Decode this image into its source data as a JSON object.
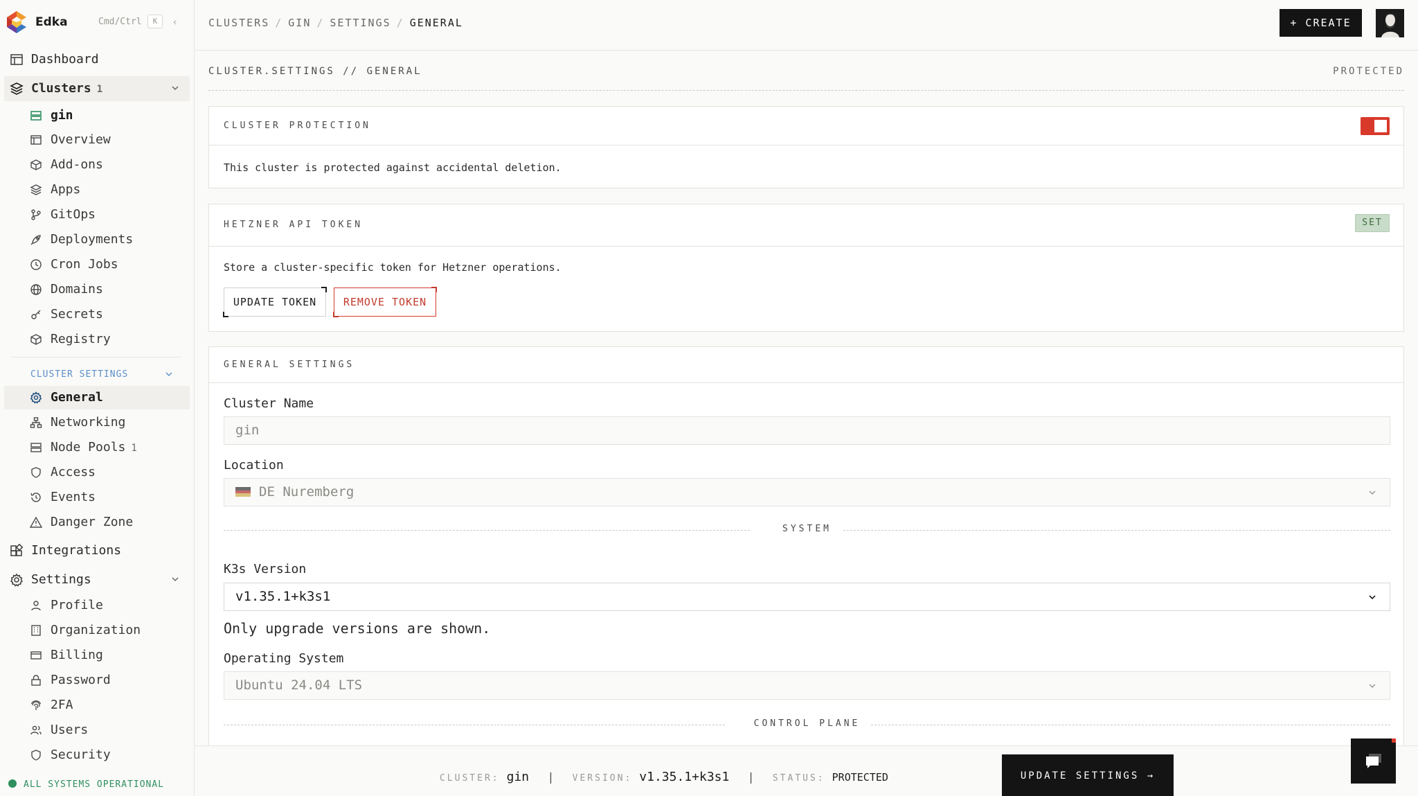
{
  "app": {
    "name": "Edka",
    "shortcut": "Cmd/Ctrl",
    "shortcut_key": "K"
  },
  "sidebar": {
    "dashboard": "Dashboard",
    "clusters": {
      "label": "Clusters",
      "count": "1"
    },
    "cluster_name": "gin",
    "cluster_items": [
      {
        "label": "Overview",
        "icon": "layout-icon"
      },
      {
        "label": "Add-ons",
        "icon": "package-icon"
      },
      {
        "label": "Apps",
        "icon": "layers-icon"
      },
      {
        "label": "GitOps",
        "icon": "git-branch-icon"
      },
      {
        "label": "Deployments",
        "icon": "rocket-icon"
      },
      {
        "label": "Cron Jobs",
        "icon": "clock-icon"
      },
      {
        "label": "Domains",
        "icon": "globe-icon"
      },
      {
        "label": "Secrets",
        "icon": "key-icon"
      },
      {
        "label": "Registry",
        "icon": "package-icon"
      }
    ],
    "cluster_settings_label": "CLUSTER SETTINGS",
    "cluster_settings_items": [
      {
        "label": "General",
        "icon": "gear-icon"
      },
      {
        "label": "Networking",
        "icon": "network-icon"
      },
      {
        "label": "Node Pools",
        "icon": "server-icon",
        "count": "1"
      },
      {
        "label": "Access",
        "icon": "shield-icon"
      },
      {
        "label": "Events",
        "icon": "history-icon"
      },
      {
        "label": "Danger Zone",
        "icon": "warning-icon"
      }
    ],
    "integrations": "Integrations",
    "settings": "Settings",
    "settings_items": [
      {
        "label": "Profile",
        "icon": "user-icon"
      },
      {
        "label": "Organization",
        "icon": "building-icon"
      },
      {
        "label": "Billing",
        "icon": "credit-card-icon"
      },
      {
        "label": "Password",
        "icon": "lock-icon"
      },
      {
        "label": "2FA",
        "icon": "fingerprint-icon"
      },
      {
        "label": "Users",
        "icon": "users-icon"
      },
      {
        "label": "Security",
        "icon": "shield-icon"
      }
    ],
    "status": "ALL SYSTEMS OPERATIONAL"
  },
  "topbar": {
    "breadcrumbs": [
      "CLUSTERS",
      "GIN",
      "SETTINGS",
      "GENERAL"
    ],
    "create_label": "+ CREATE"
  },
  "page": {
    "label": "CLUSTER.SETTINGS // GENERAL",
    "right_label": "PROTECTED"
  },
  "protection": {
    "title": "CLUSTER PROTECTION",
    "description": "This cluster is protected against accidental deletion.",
    "enabled": true
  },
  "token": {
    "title": "HETZNER API TOKEN",
    "badge": "SET",
    "description": "Store a cluster-specific token for Hetzner operations.",
    "update_label": "UPDATE TOKEN",
    "remove_label": "REMOVE TOKEN"
  },
  "general": {
    "title": "GENERAL SETTINGS",
    "cluster_name_label": "Cluster Name",
    "cluster_name_value": "gin",
    "location_label": "Location",
    "location_value": "DE Nuremberg",
    "system_section": "SYSTEM",
    "k3s_label": "K3s Version",
    "k3s_value": "v1.35.1+k3s1",
    "k3s_hint": "Only upgrade versions are shown.",
    "os_label": "Operating System",
    "os_value": "Ubuntu 24.04 LTS",
    "control_plane_section": "CONTROL PLANE"
  },
  "footer": {
    "cluster_key": "CLUSTER:",
    "cluster_value": "gin",
    "version_key": "VERSION:",
    "version_value": "v1.35.1+k3s1",
    "status_key": "STATUS:",
    "status_value": "PROTECTED",
    "update_label": "UPDATE SETTINGS →"
  },
  "colors": {
    "accent_red": "#d8392b",
    "status_green": "#2f8f5e",
    "section_blue": "#5b8fc8"
  }
}
